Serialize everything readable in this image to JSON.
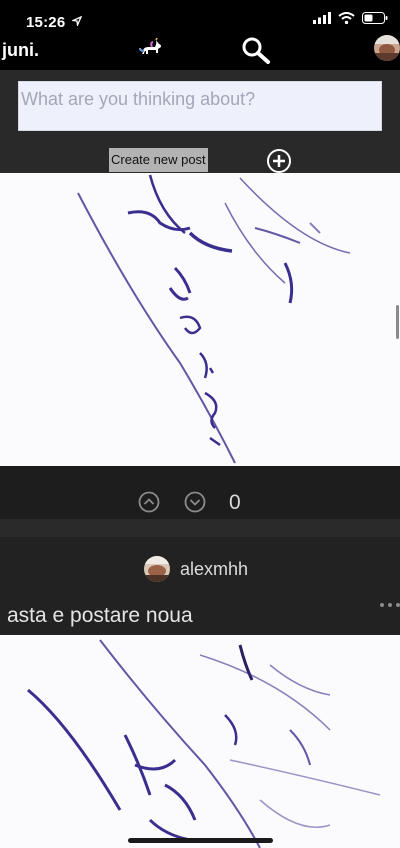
{
  "status_bar": {
    "time": "15:26",
    "icons": [
      "location-arrow-icon",
      "signal-icon",
      "wifi-icon",
      "battery-icon"
    ]
  },
  "nav": {
    "logo": "juni.",
    "icons": [
      "unicorn-icon",
      "search-icon",
      "profile-avatar"
    ]
  },
  "composer": {
    "placeholder": "What are you thinking about?",
    "value": "",
    "create_label": "Create new post",
    "add_icon": "add-circle-icon"
  },
  "posts": [
    {
      "image": "handwritten-signature-image",
      "votes": {
        "up_icon": "chevron-up-circle-icon",
        "down_icon": "chevron-down-circle-icon",
        "count": "0"
      }
    },
    {
      "author": "alexmhh",
      "caption": "asta e postare noua",
      "more_icon": "ellipsis-icon",
      "image": "handwritten-signature-image"
    }
  ],
  "colors": {
    "background": "#000000",
    "composer_bg": "#292929",
    "input_bg": "#eef0fb",
    "button_bg": "#b3b3b3",
    "ink": "#3a2f8f",
    "vote_bar_bg": "#1d1d1d",
    "post_header_bg": "#222222"
  }
}
